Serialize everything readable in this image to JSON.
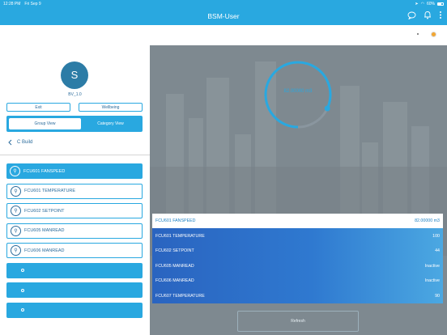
{
  "status_bar": {
    "time": "12:28 PM",
    "date": "Fri Sep 9",
    "battery": "60%",
    "battery_level": 0.6
  },
  "nav": {
    "title": "BSM-User",
    "icons": [
      "chat-icon",
      "bell-icon",
      "more-vertical-icon"
    ]
  },
  "profile": {
    "avatar_letter": "S",
    "name": "BV_1.0"
  },
  "buttons": {
    "exit": "Exit",
    "wellbeing": "Wellbeing"
  },
  "view_toggle": {
    "group": "Group View",
    "category": "Category View",
    "selected": "group"
  },
  "back": {
    "label": "C Build"
  },
  "items": [
    {
      "label": "FCU601 FANSPEED",
      "state": "selected"
    },
    {
      "label": "FCU601 TEMPERATURE",
      "state": "outline"
    },
    {
      "label": "FCU602 SETPOINT",
      "state": "outline"
    },
    {
      "label": "FCU605 MANREAD",
      "state": "outline"
    },
    {
      "label": "FCU606 MANREAD",
      "state": "outline"
    },
    {
      "label": "",
      "state": "plain"
    },
    {
      "label": "",
      "state": "plain"
    },
    {
      "label": "",
      "state": "plain"
    }
  ],
  "gauge": {
    "value_text": "82.00000 m3",
    "fraction": 0.82,
    "color": "#29a8e0"
  },
  "readings": [
    {
      "name": "FCU601 FANSPEED",
      "value": "82.00000 m3"
    },
    {
      "name": "FCU601 TEMPERATURE",
      "value": "100"
    },
    {
      "name": "FCU602 SETPOINT",
      "value": "44"
    },
    {
      "name": "FCU605 MANREAD",
      "value": "Inactive"
    },
    {
      "name": "FCU606 MANREAD",
      "value": "Inactive"
    },
    {
      "name": "FCU607 TEMPERATURE",
      "value": "90"
    }
  ],
  "bottom_button": {
    "label": "Refresh"
  },
  "colors": {
    "accent": "#29a8e0",
    "dark_text": "#2b6c9c",
    "panel_bg": "#7f8a91"
  }
}
